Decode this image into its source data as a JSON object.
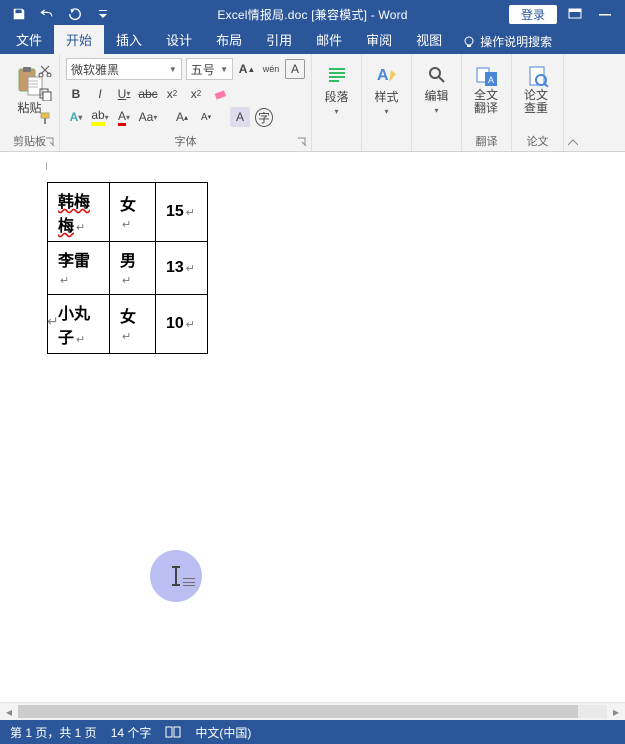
{
  "titlebar": {
    "title": "Excel情报局.doc [兼容模式] - Word",
    "login": "登录"
  },
  "tabs": {
    "file": "文件",
    "home": "开始",
    "insert": "插入",
    "design": "设计",
    "layout": "布局",
    "references": "引用",
    "mailings": "邮件",
    "review": "审阅",
    "view": "视图",
    "tell_me": "操作说明搜索"
  },
  "ribbon": {
    "clipboard": {
      "paste": "粘贴",
      "label": "剪贴板"
    },
    "font": {
      "name": "微软雅黑",
      "size": "五号",
      "label": "字体"
    },
    "paragraph": {
      "btn": "段落"
    },
    "styles": {
      "btn": "样式"
    },
    "editing": {
      "btn": "编辑"
    },
    "translate": {
      "btn": "全文翻译",
      "label": "翻译"
    },
    "check": {
      "btn": "论文查重",
      "label": "论文"
    }
  },
  "table": {
    "rows": [
      {
        "c1": "韩梅梅",
        "c2": "女",
        "c3": "15",
        "c1_squiggle": true
      },
      {
        "c1": "李雷",
        "c2": "男",
        "c3": "13",
        "c1_squiggle": false
      },
      {
        "c1": "小丸子",
        "c2": "女",
        "c3": "10",
        "c1_squiggle": false
      }
    ]
  },
  "status": {
    "page": "第 1 页，共 1 页",
    "words": "14 个字",
    "language": "中文(中国)"
  }
}
